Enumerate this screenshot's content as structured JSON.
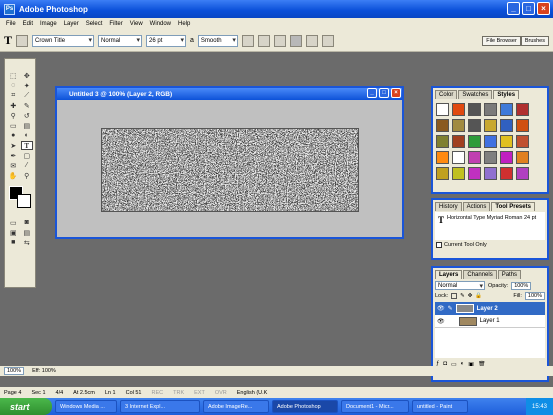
{
  "app": {
    "title": "Adobe Photoshop"
  },
  "menu": [
    "File",
    "Edit",
    "Image",
    "Layer",
    "Select",
    "Filter",
    "View",
    "Window",
    "Help"
  ],
  "options": {
    "font_family": "Crown Title",
    "font_style": "Normal",
    "font_size": "26 pt",
    "aa_label": "a",
    "antialias": "Smooth"
  },
  "palette_well": {
    "file_browser": "File Browser",
    "brushes": "Brushes"
  },
  "document": {
    "title": "Untitled 3 @ 100% (Layer 2, RGB)"
  },
  "styles_panel": {
    "tabs": [
      "Color",
      "Swatches",
      "Styles"
    ]
  },
  "history_panel": {
    "tabs": [
      "History",
      "Actions",
      "Tool Presets"
    ],
    "preset": "Horizontal Type Myriad Roman 24 pt",
    "current_tool_only": "Current Tool Only"
  },
  "layers_panel": {
    "tabs": [
      "Layers",
      "Channels",
      "Paths"
    ],
    "blend": "Normal",
    "opacity_label": "Opacity:",
    "opacity": "100%",
    "lock_label": "Lock:",
    "fill_label": "Fill:",
    "fill": "100%",
    "layers": [
      "Layer 2",
      "Layer 1"
    ]
  },
  "doc_status": {
    "zoom": "100%",
    "info": "Eff: 100%"
  },
  "word_status": {
    "page": "Page 4",
    "sec": "Sec 1",
    "pages": "4/4",
    "at": "At 2.5cm",
    "ln": "Ln 1",
    "col": "Col 51",
    "rec": "REC",
    "trk": "TRK",
    "ext": "EXT",
    "ovr": "OVR",
    "lang": "English (U.K"
  },
  "taskbar": {
    "start": "start",
    "tasks": [
      "Windows Media ...",
      "3 Internet Expl...",
      "Adobe ImageRe...",
      "Adobe Photoshop",
      "Document1 - Micr...",
      "untitled - Paint"
    ],
    "clock": "15:43"
  }
}
